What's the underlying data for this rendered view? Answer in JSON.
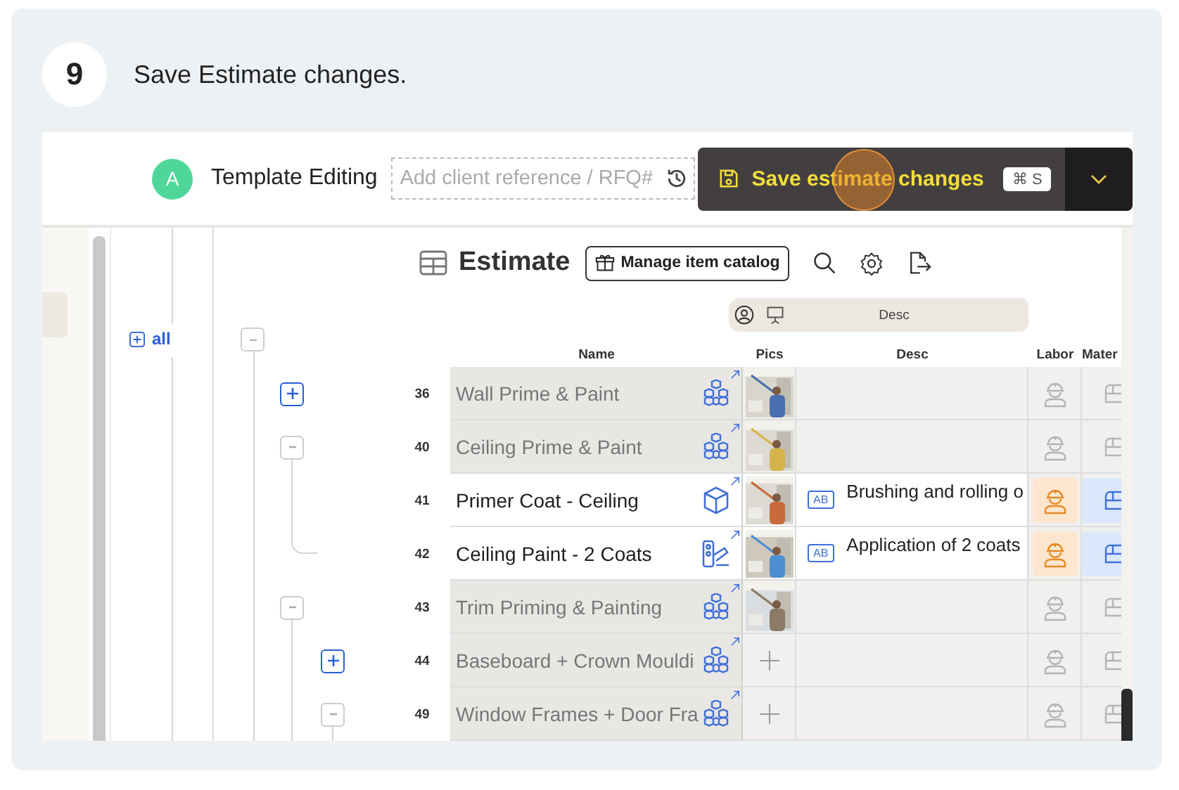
{
  "step": {
    "number": "9",
    "title": "Save Estimate changes."
  },
  "header": {
    "avatar": "A",
    "title": "Template Editing",
    "reference_field": {
      "placeholder": "Add client reference / RFQ#"
    },
    "save_button": {
      "label": "Save estimate changes",
      "shortcut": "⌘ S",
      "clicked": true
    }
  },
  "sidebar": {
    "expand_all": "all"
  },
  "toolbar": {
    "title": "Estimate",
    "catalog_button": "Manage item catalog"
  },
  "column_tab": "Desc",
  "columns": [
    "Name",
    "Pics",
    "Desc",
    "Labor",
    "Mater"
  ],
  "tree_root": {
    "expanded": true
  },
  "rows": [
    {
      "number": "36",
      "name": "Wall Prime & Paint",
      "kind": "group",
      "expanded": false,
      "photo": true,
      "labor": false,
      "materials": false
    },
    {
      "number": "40",
      "name": "Ceiling Prime & Paint",
      "kind": "group",
      "expanded": true,
      "photo": true,
      "labor": false,
      "materials": false,
      "children": [
        {
          "number": "41",
          "name": "Primer Coat - Ceiling",
          "kind": "item",
          "photo": true,
          "desc_badge": "AB",
          "description": "Brushing and rolling o",
          "labor": true,
          "materials": true
        },
        {
          "number": "42",
          "name": "Ceiling Paint - 2 Coats",
          "kind": "finish",
          "photo": true,
          "desc_badge": "AB",
          "description": "Application of 2 coats",
          "labor": true,
          "materials": true
        }
      ]
    },
    {
      "number": "43",
      "name": "Trim Priming & Painting",
      "kind": "group",
      "expanded": true,
      "photo": true,
      "labor": false,
      "materials": false,
      "children": [
        {
          "number": "44",
          "name": "Baseboard + Crown Mouldi",
          "kind": "group",
          "expanded": false,
          "photo": false,
          "labor": false,
          "materials": false
        },
        {
          "number": "49",
          "name": "Window Frames + Door Fra",
          "kind": "group",
          "expanded": true,
          "photo": false,
          "labor": false,
          "materials": false
        }
      ]
    }
  ]
}
